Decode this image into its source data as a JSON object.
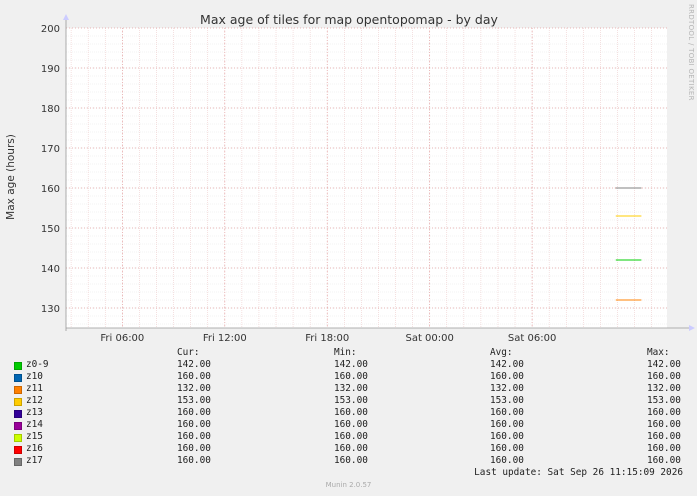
{
  "chart_data": {
    "type": "line",
    "title": "Max age of tiles for map opentopomap - by day",
    "ylabel": "Max age (hours)",
    "xlabel": "",
    "ylim": [
      125,
      200
    ],
    "y_ticks": [
      130,
      140,
      150,
      160,
      170,
      180,
      190,
      200
    ],
    "x_ticks": [
      "Fri 06:00",
      "Fri 12:00",
      "Fri 18:00",
      "Sat 00:00",
      "Sat 06:00"
    ],
    "x_domain_hours": [
      -3.3,
      31.9
    ],
    "x_tick_hours": [
      0,
      6,
      12,
      18,
      24
    ],
    "data_span_hours": [
      28.9,
      30.4
    ],
    "grid": true,
    "series": [
      {
        "name": "z0-9",
        "color": "#00cc00",
        "values": [
          142.0,
          142.0
        ]
      },
      {
        "name": "z10",
        "color": "#0066b3",
        "values": [
          160.0,
          160.0
        ]
      },
      {
        "name": "z11",
        "color": "#ff8000",
        "values": [
          132.0,
          132.0
        ]
      },
      {
        "name": "z12",
        "color": "#ffcc00",
        "values": [
          153.0,
          153.0
        ]
      },
      {
        "name": "z13",
        "color": "#330099",
        "values": [
          160.0,
          160.0
        ]
      },
      {
        "name": "z14",
        "color": "#990099",
        "values": [
          160.0,
          160.0
        ]
      },
      {
        "name": "z15",
        "color": "#ccff00",
        "values": [
          160.0,
          160.0
        ]
      },
      {
        "name": "z16",
        "color": "#ff0000",
        "values": [
          160.0,
          160.0
        ]
      },
      {
        "name": "z17",
        "color": "#808080",
        "values": [
          160.0,
          160.0
        ]
      }
    ]
  },
  "legend": {
    "headers": {
      "cur": "Cur:",
      "min": "Min:",
      "avg": "Avg:",
      "max": "Max:"
    },
    "rows": [
      {
        "name": "z0-9",
        "color": "#00cc00",
        "cur": "142.00",
        "min": "142.00",
        "avg": "142.00",
        "max": "142.00"
      },
      {
        "name": "z10",
        "color": "#0066b3",
        "cur": "160.00",
        "min": "160.00",
        "avg": "160.00",
        "max": "160.00"
      },
      {
        "name": "z11",
        "color": "#ff8000",
        "cur": "132.00",
        "min": "132.00",
        "avg": "132.00",
        "max": "132.00"
      },
      {
        "name": "z12",
        "color": "#ffcc00",
        "cur": "153.00",
        "min": "153.00",
        "avg": "153.00",
        "max": "153.00"
      },
      {
        "name": "z13",
        "color": "#330099",
        "cur": "160.00",
        "min": "160.00",
        "avg": "160.00",
        "max": "160.00"
      },
      {
        "name": "z14",
        "color": "#990099",
        "cur": "160.00",
        "min": "160.00",
        "avg": "160.00",
        "max": "160.00"
      },
      {
        "name": "z15",
        "color": "#ccff00",
        "cur": "160.00",
        "min": "160.00",
        "avg": "160.00",
        "max": "160.00"
      },
      {
        "name": "z16",
        "color": "#ff0000",
        "cur": "160.00",
        "min": "160.00",
        "avg": "160.00",
        "max": "160.00"
      },
      {
        "name": "z17",
        "color": "#808080",
        "cur": "160.00",
        "min": "160.00",
        "avg": "160.00",
        "max": "160.00"
      }
    ]
  },
  "last_update": "Last update: Sat Sep 26 11:15:09 2026",
  "footer": "Munin 2.0.57",
  "side_label": "RRDTOOL / TOBI OETIKER"
}
